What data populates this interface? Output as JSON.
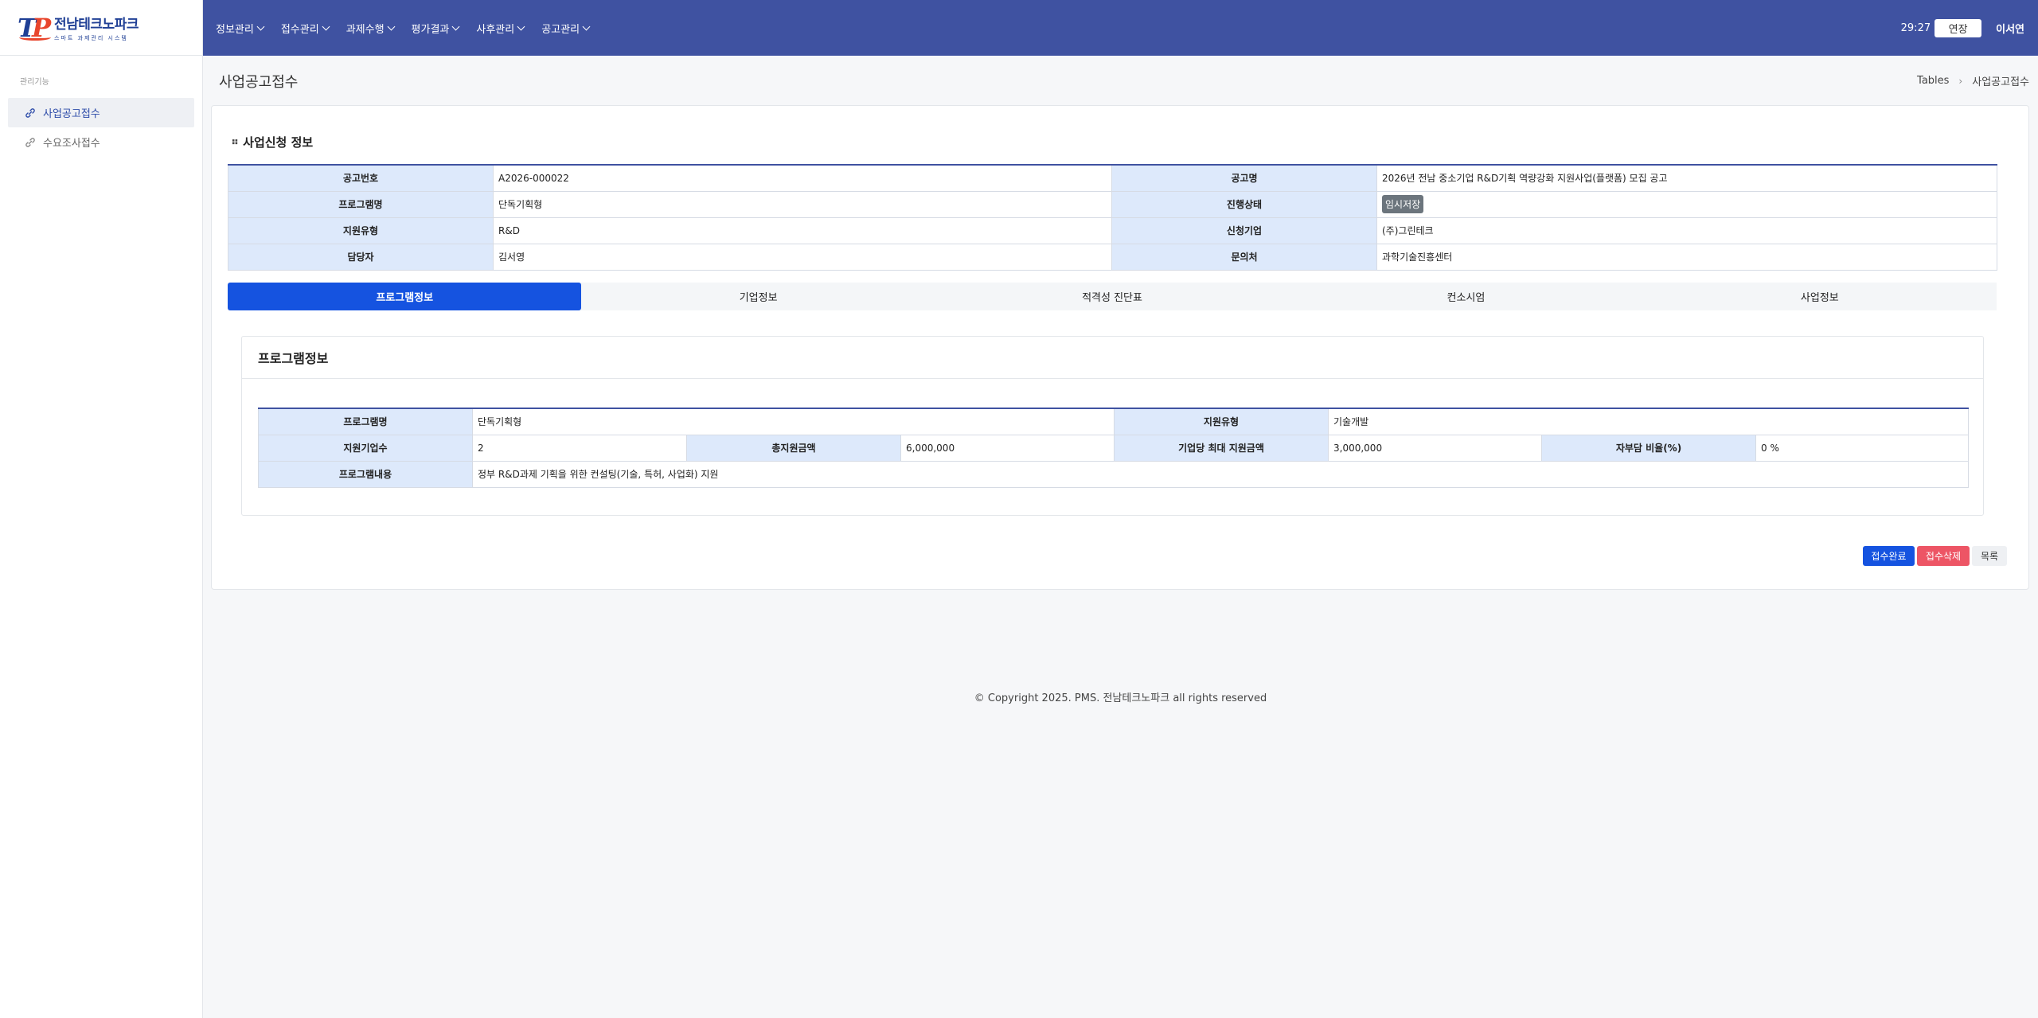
{
  "logo": {
    "title": "전남테크노파크",
    "subtitle": "스마트 과제관리 시스템",
    "mark_t": "T",
    "mark_p": "P"
  },
  "sidebar": {
    "section_label": "관리기능",
    "items": [
      {
        "label": "사업공고접수",
        "icon": "link-icon",
        "active": true
      },
      {
        "label": "수요조사접수",
        "icon": "link-icon",
        "active": false
      }
    ]
  },
  "header": {
    "menu": [
      "정보관리",
      "접수관리",
      "과제수행",
      "평가결과",
      "사후관리",
      "공고관리"
    ],
    "timer": "29:27",
    "extend_label": "연장",
    "user": "이서연",
    "bg_color": "#3f52a1"
  },
  "page": {
    "title": "사업공고접수",
    "breadcrumb": [
      "Tables",
      "사업공고접수"
    ]
  },
  "application": {
    "section_title": "사업신청 정보",
    "rows": [
      {
        "l1": "공고번호",
        "v1": "A2026-000022",
        "l2": "공고명",
        "v2": "2026년 전남 중소기업 R&D기획 역량강화 지원사업(플랫폼) 모집 공고"
      },
      {
        "l1": "프로그램명",
        "v1": "단독기획형",
        "l2": "진행상태",
        "v2": "임시저장"
      },
      {
        "l1": "지원유형",
        "v1": "R&D",
        "l2": "신청기업",
        "v2": "(주)그린테크"
      },
      {
        "l1": "담당자",
        "v1": "김서영",
        "l2": "문의처",
        "v2": "과학기술진흥센터"
      }
    ]
  },
  "tabs": [
    "프로그램정보",
    "기업정보",
    "적격성 진단표",
    "컨소시엄",
    "사업정보"
  ],
  "program": {
    "title": "프로그램정보",
    "name_label": "프로그램명",
    "name": "단독기획형",
    "type_label": "지원유형",
    "type": "기술개발",
    "count_label": "지원기업수",
    "count": "2",
    "total_label": "총지원금액",
    "total": "6,000,000",
    "max_label": "기업당 최대 지원금액",
    "max": "3,000,000",
    "ratio_label": "자부담 비율(%)",
    "ratio": "0 %",
    "content_label": "프로그램내용",
    "content": "정부 R&D과제 기획을 위한 컨설팅(기술, 특허, 사업화) 지원"
  },
  "actions": {
    "complete": "접수완료",
    "delete": "접수삭제",
    "list": "목록"
  },
  "footer": "© Copyright 2025. PMS. 전남테크노파크 all rights reserved",
  "colors": {
    "primary": "#1553e0",
    "danger": "#ed5565",
    "label_bg": "#dde9fb",
    "status_badge": "#6c757d"
  }
}
